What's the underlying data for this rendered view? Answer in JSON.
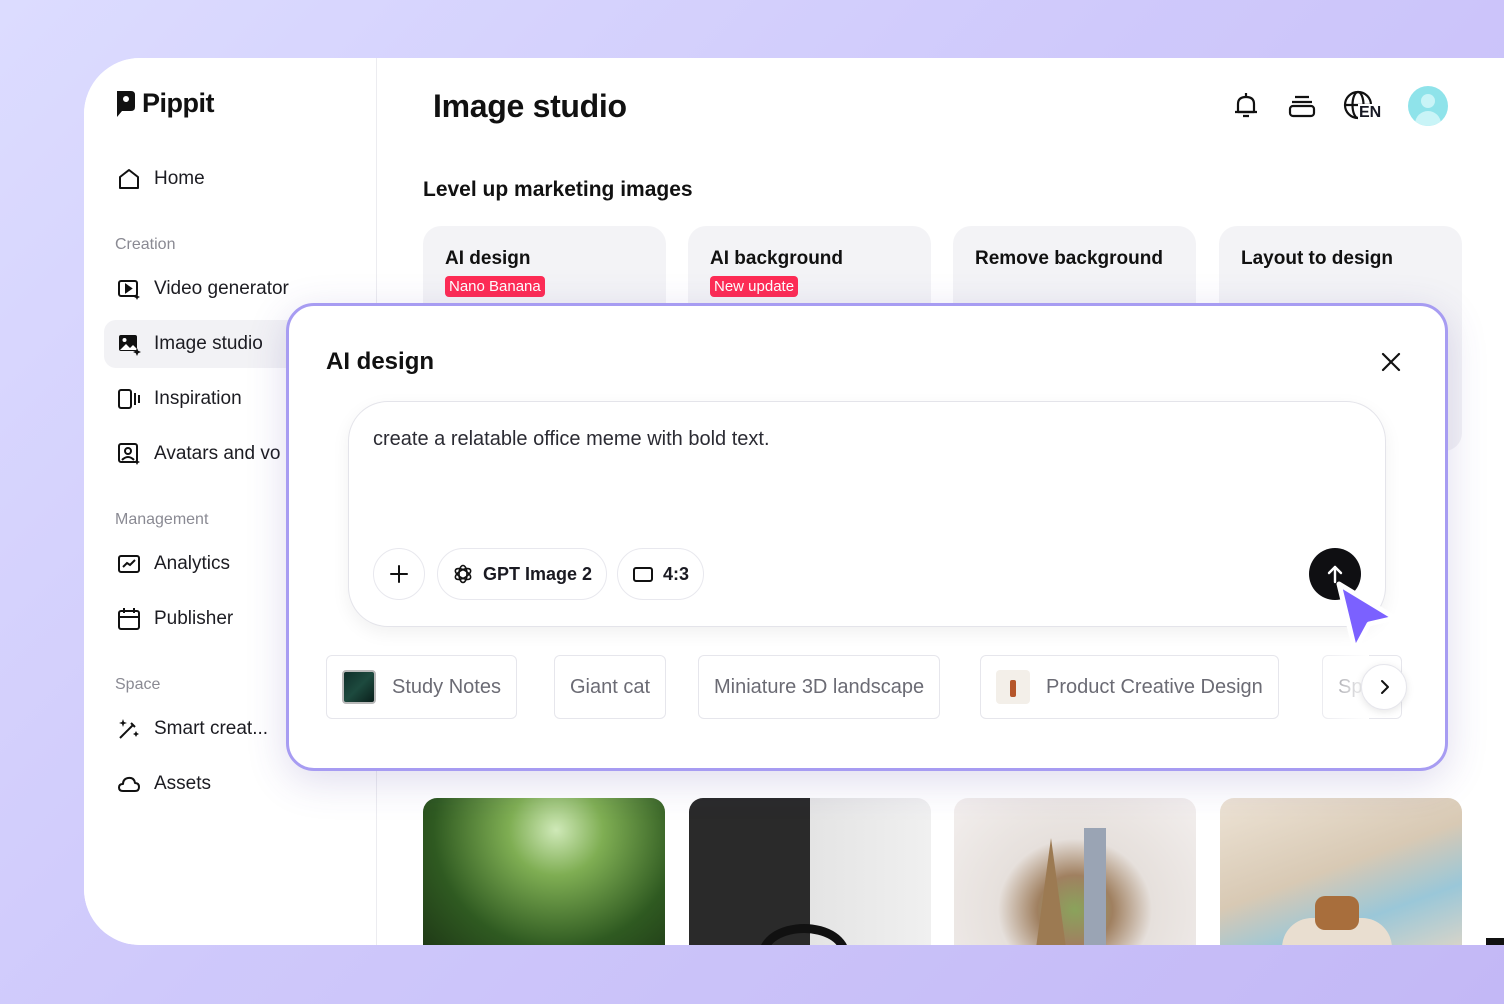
{
  "app": {
    "name": "Pippit"
  },
  "sidebar": {
    "home": "Home",
    "sections": {
      "creation": "Creation",
      "management": "Management",
      "space": "Space"
    },
    "items": {
      "video_generator": "Video generator",
      "image_studio": "Image studio",
      "inspiration": "Inspiration",
      "avatars": "Avatars and vo",
      "analytics": "Analytics",
      "publisher": "Publisher",
      "smart_creation": "Smart creat...",
      "assets": "Assets"
    }
  },
  "header": {
    "title": "Image studio",
    "language": "EN"
  },
  "main": {
    "section_title": "Level up marketing images",
    "tools": [
      {
        "name": "AI design",
        "badge": "Nano Banana"
      },
      {
        "name": "AI background",
        "badge": "New update"
      },
      {
        "name": "Remove background",
        "badge": ""
      },
      {
        "name": "Layout to design",
        "badge": ""
      }
    ]
  },
  "modal": {
    "title": "AI design",
    "prompt": "create a relatable office meme with bold text.",
    "model": "GPT Image 2",
    "ratio": "4:3",
    "suggestions": [
      "Study Notes",
      "Giant cat",
      "Miniature 3D landscape",
      "Product Creative Design",
      "Sp"
    ]
  },
  "colors": {
    "accent": "#a79cf2",
    "badge": "#fe2c55",
    "cursor": "#7b61ff"
  }
}
